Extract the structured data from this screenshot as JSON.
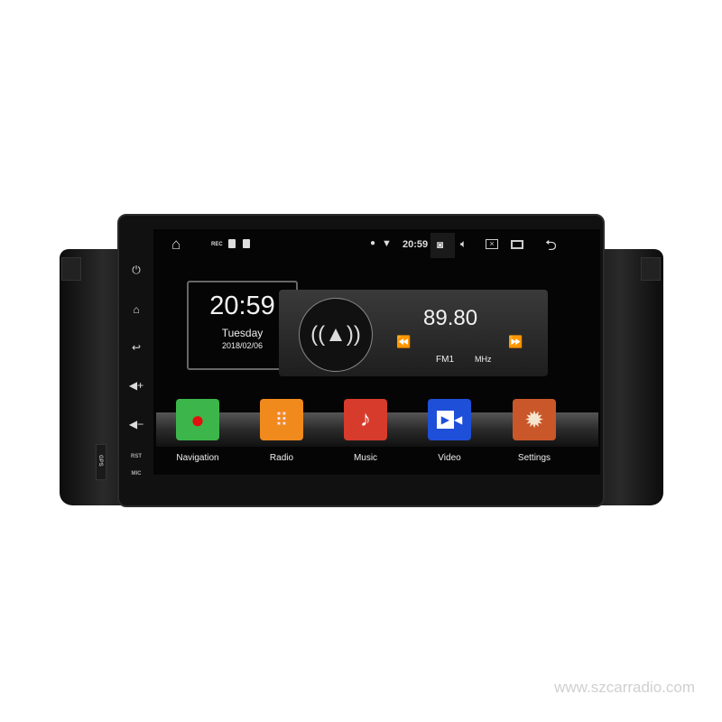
{
  "status_bar": {
    "rec": "REC",
    "time": "20:59",
    "icons": [
      "home-icon",
      "rec-icon",
      "sd-card-icon",
      "sd-card-icon",
      "location-icon",
      "wifi-icon",
      "camera-icon",
      "volume-icon",
      "close-box-icon",
      "recent-apps-icon",
      "back-icon"
    ]
  },
  "side_buttons": {
    "icons": [
      "power-icon",
      "home-icon",
      "back-icon",
      "volume-up-icon",
      "volume-down-icon"
    ],
    "rst": "RST",
    "mic": "MIC",
    "gps": "GPS"
  },
  "clock_widget": {
    "time": "20:59",
    "day": "Tuesday",
    "date": "2018/02/06"
  },
  "radio_widget": {
    "frequency": "89.80",
    "band": "FM1",
    "unit": "MHz",
    "prev": "⏪",
    "next": "⏩"
  },
  "apps": [
    {
      "label": "Navigation",
      "color": "#3cb64a"
    },
    {
      "label": "Radio",
      "color": "#f08a1c"
    },
    {
      "label": "Music",
      "color": "#d63b2b"
    },
    {
      "label": "Video",
      "color": "#1e4fd8"
    },
    {
      "label": "Settings",
      "color": "#c9572a"
    }
  ],
  "watermark": "www.szcarradio.com"
}
